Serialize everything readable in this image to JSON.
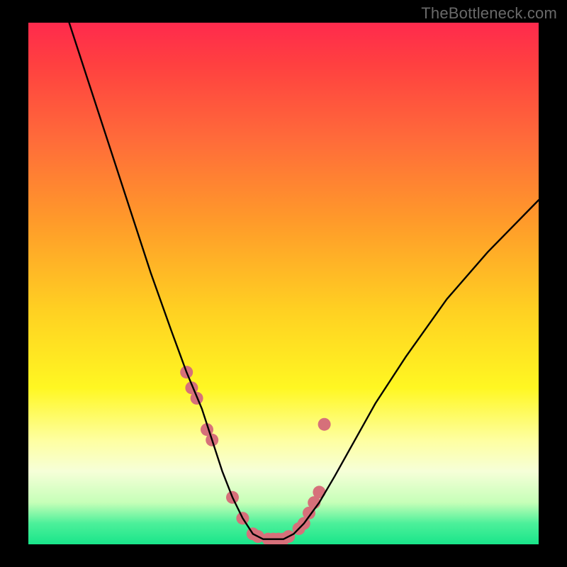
{
  "watermark": "TheBottleneck.com",
  "chart_data": {
    "type": "line",
    "title": "",
    "xlabel": "",
    "ylabel": "",
    "xlim": [
      0,
      100
    ],
    "ylim": [
      0,
      100
    ],
    "series": [
      {
        "name": "bottleneck-curve",
        "x": [
          8,
          12,
          16,
          20,
          24,
          28,
          31,
          34,
          36,
          38,
          40,
          42,
          44,
          46,
          48,
          50,
          52,
          54,
          57,
          60,
          64,
          68,
          74,
          82,
          90,
          100
        ],
        "y": [
          100,
          88,
          76,
          64,
          52,
          41,
          33,
          26,
          20,
          14,
          9,
          5,
          2,
          1,
          1,
          1,
          2,
          4,
          8,
          13,
          20,
          27,
          36,
          47,
          56,
          66
        ]
      }
    ],
    "markers": {
      "name": "highlight-points",
      "color": "#d6707a",
      "x": [
        31,
        32,
        33,
        35,
        36,
        40,
        42,
        44,
        45,
        47,
        48,
        49,
        50,
        51,
        53,
        54,
        55,
        56,
        57,
        58
      ],
      "y": [
        33,
        30,
        28,
        22,
        20,
        9,
        5,
        2,
        1.5,
        1,
        1,
        1,
        1,
        1.5,
        3,
        4,
        6,
        8,
        10,
        23
      ]
    }
  }
}
